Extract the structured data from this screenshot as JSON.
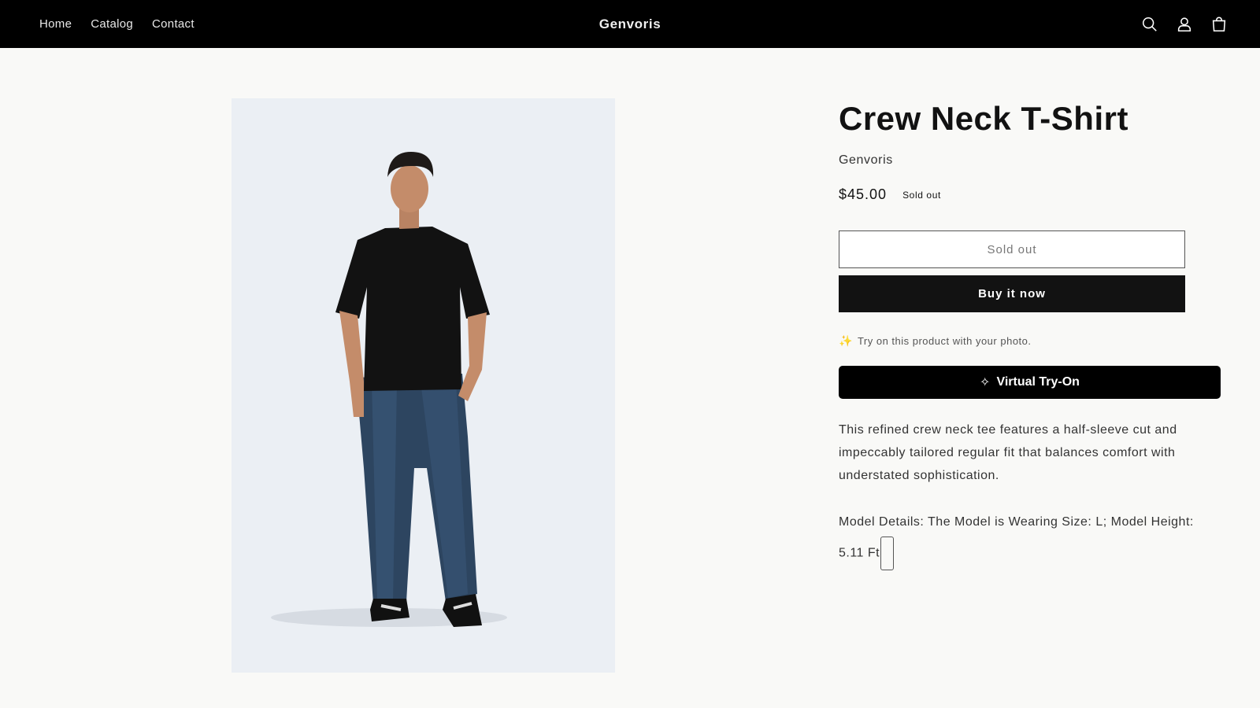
{
  "header": {
    "nav": [
      "Home",
      "Catalog",
      "Contact"
    ],
    "brand": "Genvoris",
    "icons": [
      "search-icon",
      "account-icon",
      "cart-icon"
    ],
    "background": "#000000"
  },
  "product": {
    "title": "Crew Neck T-Shirt",
    "vendor": "Genvoris",
    "price": "$45.00",
    "badge": "Sold out",
    "sold_out_button": "Sold out",
    "buy_button": "Buy it now",
    "tryon_hint": "Try on this product with your photo.",
    "tryon_hint_icon": "sparkle-icon",
    "tryon_button": "Virtual Try-On",
    "tryon_button_icon": "sparkle-icon",
    "description": "This refined crew neck tee features a half-sleeve cut and impeccably tailored regular fit that balances comfort with understated sophistication.",
    "model_details": "Model Details: The Model is Wearing Size: L; Model Height: 5.11 Ft",
    "image_alt": "model-photo"
  },
  "colors": {
    "page_bg": "#f9f9f7",
    "media_bg": "#ebeff4",
    "primary_button": "#121212",
    "accent_sparkle": "#f0b400"
  }
}
